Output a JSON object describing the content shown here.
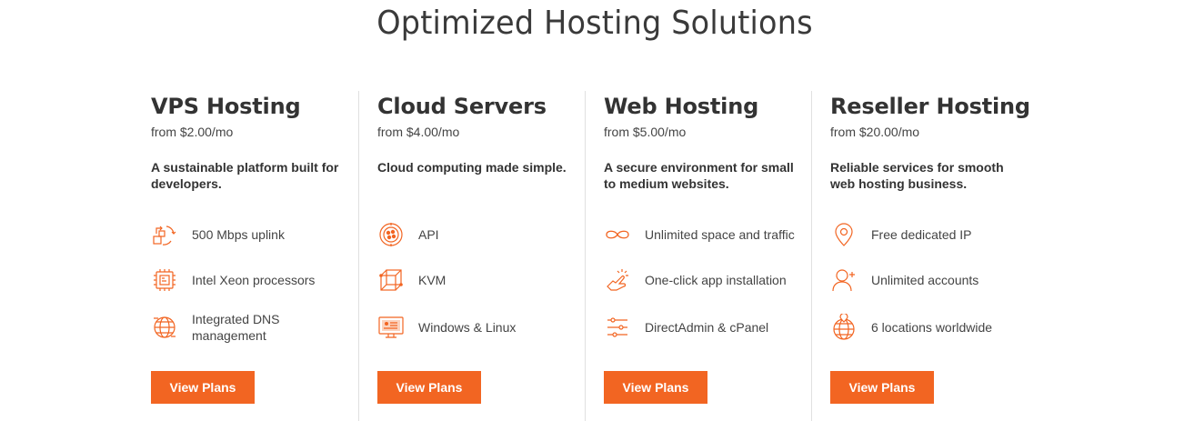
{
  "page": {
    "title": "Optimized Hosting Solutions",
    "accent_color": "#f26522"
  },
  "cards": [
    {
      "title": "VPS Hosting",
      "price": "from $2.00/mo",
      "description": "A sustainable platform built for developers.",
      "features": [
        {
          "icon": "arrows-sync-icon",
          "label": "500 Mbps uplink"
        },
        {
          "icon": "cpu-chip-icon",
          "label": "Intel Xeon processors"
        },
        {
          "icon": "globe-dns-icon",
          "label": "Integrated DNS management"
        }
      ],
      "button": "View Plans"
    },
    {
      "title": "Cloud Servers",
      "price": "from $4.00/mo",
      "description": "Cloud computing made simple.",
      "features": [
        {
          "icon": "api-circle-icon",
          "label": "API"
        },
        {
          "icon": "cube-kvm-icon",
          "label": "KVM"
        },
        {
          "icon": "monitor-icon",
          "label": "Windows & Linux"
        }
      ],
      "button": "View Plans"
    },
    {
      "title": "Web Hosting",
      "price": "from $5.00/mo",
      "description": "A secure environment for small to medium websites.",
      "features": [
        {
          "icon": "infinity-icon",
          "label": "Unlimited space and traffic"
        },
        {
          "icon": "tap-click-icon",
          "label": "One-click app installation"
        },
        {
          "icon": "sliders-icon",
          "label": "DirectAdmin & cPanel"
        }
      ],
      "button": "View Plans"
    },
    {
      "title": "Reseller Hosting",
      "price": "from $20.00/mo",
      "description": "Reliable services for smooth web hosting business.",
      "features": [
        {
          "icon": "location-pin-icon",
          "label": "Free dedicated IP"
        },
        {
          "icon": "add-user-icon",
          "label": "Unlimited accounts"
        },
        {
          "icon": "globe-pin-icon",
          "label": "6 locations worldwide"
        }
      ],
      "button": "View Plans"
    }
  ]
}
